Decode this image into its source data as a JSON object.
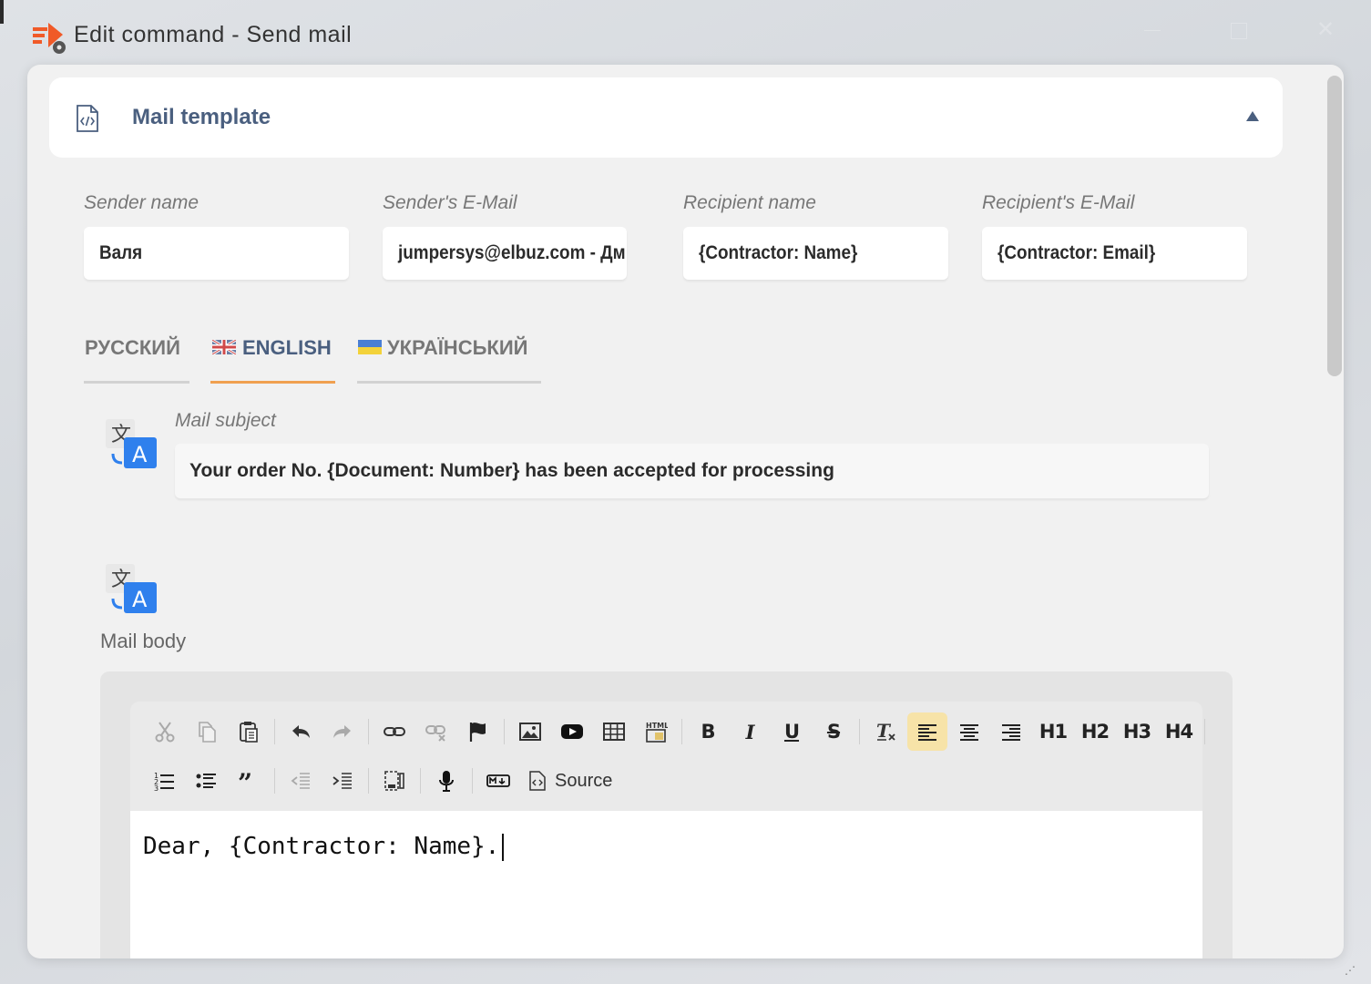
{
  "window": {
    "title": "Edit command - Send mail",
    "controls": [
      "minimize-icon",
      "maximize-icon",
      "close-icon"
    ]
  },
  "template_card": {
    "icon": "code-file-icon",
    "title": "Mail template",
    "collapse_icon": "triangle-up-icon"
  },
  "fields": [
    {
      "label": "Sender name",
      "value": "Валя"
    },
    {
      "label": "Sender's E-Mail",
      "value": "jumpersys@elbuz.com - Дм"
    },
    {
      "label": "Recipient name",
      "value": "{Contractor: Name}"
    },
    {
      "label": "Recipient's E-Mail",
      "value": "{Contractor: Email}"
    }
  ],
  "language_tabs": [
    {
      "label": "РУССКИЙ",
      "flag": ""
    },
    {
      "label": "ENGLISH",
      "flag": "uk-flag",
      "active": true
    },
    {
      "label": "УКРАЇНСЬКИЙ",
      "flag": "ukraine-flag"
    }
  ],
  "subject": {
    "label": "Mail subject",
    "value": "Your order No. {Document: Number} has been accepted for processing",
    "icon": "translate-icon"
  },
  "body": {
    "label": "Mail body",
    "icon": "translate-icon",
    "content": "Dear, {Contractor: Name}."
  },
  "toolbar": {
    "row1": [
      "cut-icon",
      "copy-icon",
      "paste-icon",
      "undo-icon",
      "redo-icon",
      "link-icon",
      "unlink-icon",
      "anchor-flag-icon",
      "image-icon",
      "video-icon",
      "table-icon",
      "html-snippet-icon",
      "bold-icon",
      "italic-icon",
      "underline-icon",
      "strikethrough-icon",
      "remove-format-icon",
      "align-left-icon",
      "align-center-icon",
      "align-right-icon"
    ],
    "headings": [
      "H1",
      "H2",
      "H3",
      "H4"
    ],
    "row2": [
      "numbered-list-icon",
      "bulleted-list-icon",
      "blockquote-icon",
      "outdent-icon",
      "indent-icon",
      "show-blocks-icon",
      "microphone-icon",
      "markdown-icon"
    ],
    "source_label": "Source",
    "active_button": "align-left-icon"
  },
  "colors": {
    "accent_title": "#4a5f7f",
    "tab_underline_active": "#f0a050",
    "app_icon": "#f05a28",
    "active_tool": "#f7e3a8"
  }
}
